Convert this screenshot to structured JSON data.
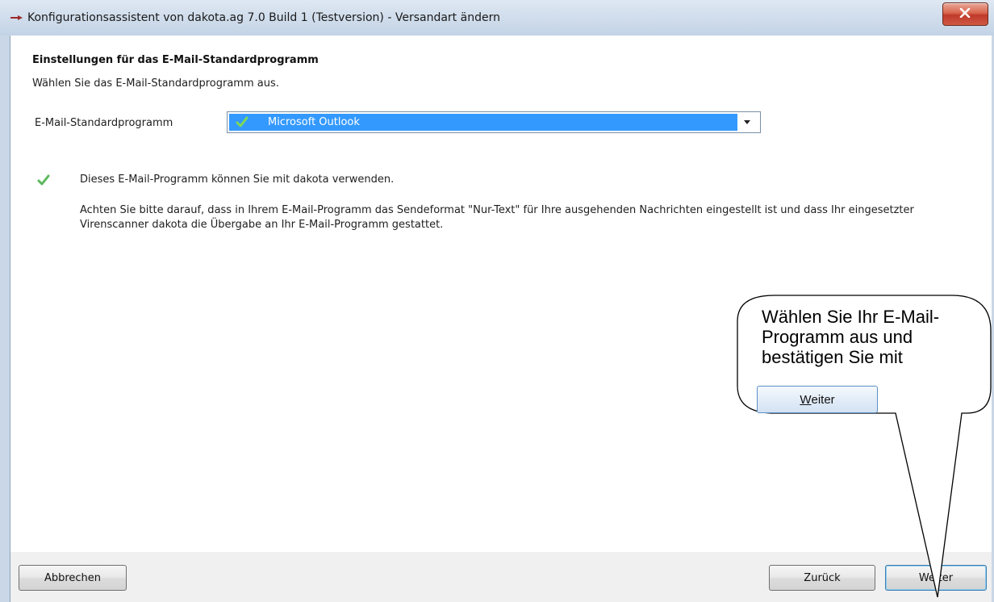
{
  "window": {
    "title": "Konfigurationsassistent von dakota.ag 7.0 Build 1 (Testversion) - Versandart ändern"
  },
  "header": {
    "section_title": "Einstellungen für das E-Mail-Standardprogramm",
    "intro": "Wählen Sie das E-Mail-Standardprogramm aus."
  },
  "form": {
    "label": "E-Mail-Standardprogramm",
    "selected_value": "Microsoft Outlook"
  },
  "status": {
    "message": "Dieses E-Mail-Programm können Sie mit dakota verwenden.",
    "note": "Achten Sie bitte darauf, dass in Ihrem E-Mail-Programm das Sendeformat \"Nur-Text\" für Ihre ausgehenden Nachrichten eingestellt ist und dass Ihr eingesetzter Virenscanner dakota die Übergabe an Ihr E-Mail-Programm gestattet."
  },
  "footer": {
    "cancel_label": "Abbrechen",
    "back_label": "Zurück",
    "next_label": "Weiter"
  },
  "callout": {
    "text": "Wählen Sie Ihr E-Mail-\nProgramm aus und\nbestätigen Sie mit",
    "button_accel": "W",
    "button_rest": "eiter"
  },
  "colors": {
    "selection": "#3399ff",
    "check": "#5cb85c",
    "close": "#c0392b"
  },
  "icons": [
    "app-arrow-icon",
    "close-icon",
    "check-icon",
    "dropdown-arrow-icon"
  ]
}
